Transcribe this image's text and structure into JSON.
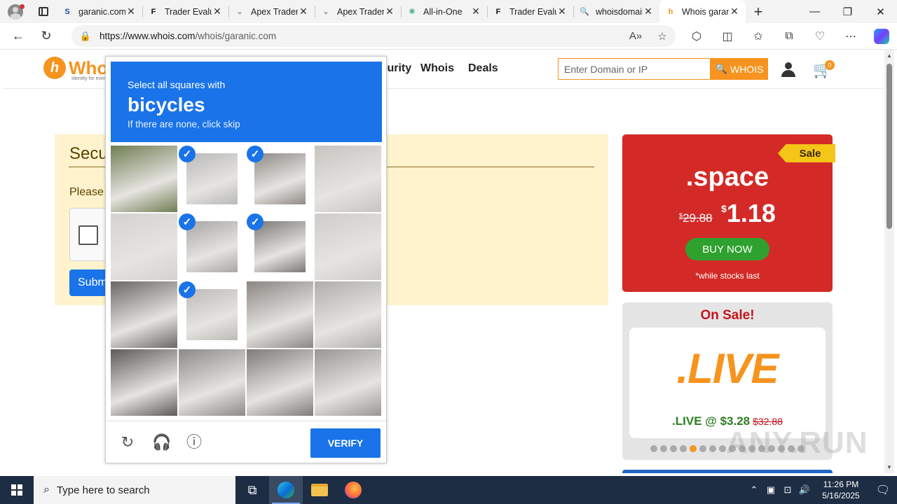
{
  "browser": {
    "tabs": [
      {
        "label": "garanic.com",
        "icon": "s-logo-icon",
        "active": false
      },
      {
        "label": "Trader Evaluation",
        "icon": "f-logo-icon",
        "active": false
      },
      {
        "label": "Apex Trader",
        "icon": "apex-icon",
        "active": false
      },
      {
        "label": "Apex Trader",
        "icon": "apex-icon",
        "active": false
      },
      {
        "label": "All-in-One",
        "icon": "allinone-icon",
        "active": false
      },
      {
        "label": "Trader Evaluation",
        "icon": "f-logo-icon",
        "active": false
      },
      {
        "label": "whoisdomain",
        "icon": "search-icon",
        "active": false
      },
      {
        "label": "Whois garanic.com",
        "icon": "whois-logo-icon",
        "active": true
      }
    ],
    "url_domain": "https://www.whois.com",
    "url_path": "/whois/garanic.com"
  },
  "site": {
    "logo_text": "Whois",
    "logo_tagline": "Identity for everyone",
    "nav": [
      "Security",
      "Whois",
      "Deals"
    ],
    "search_placeholder": "Enter Domain or IP",
    "search_button": "WHOIS",
    "cart_count": "0"
  },
  "security": {
    "title": "Security",
    "prompt": "Please",
    "submit_label": "Submit"
  },
  "promo_space": {
    "ribbon": "Sale",
    "tld": ".space",
    "old_currency": "$",
    "old_price": "29.88",
    "new_currency": "$",
    "new_price": "1.18",
    "button": "BUY NOW",
    "note": "*while stocks last"
  },
  "promo_live": {
    "title": "On Sale!",
    "logo": ".LIVE",
    "price_text": ".LIVE @ $3.28",
    "old_price": "$32.88",
    "dots_total": 16,
    "dots_active_index": 4
  },
  "captcha": {
    "instruction": "Select all squares with",
    "target": "bicycles",
    "skip_hint": "If there are none, click skip",
    "verify_label": "VERIFY",
    "selected_tiles": [
      1,
      2,
      5,
      6,
      9
    ],
    "tile_shades": [
      "#6f7d52",
      "#b9b9b9",
      "#8e8a86",
      "#c7c4c0",
      "#d4d2cf",
      "#a8a6a4",
      "#7b7876",
      "#cfcdca",
      "#6a6866",
      "#bdbbb8",
      "#8a8783",
      "#b0aeab",
      "#5d5b59",
      "#8c8a88",
      "#7e7c7a",
      "#999795"
    ]
  },
  "taskbar": {
    "search_placeholder": "Type here to search",
    "time": "11:26 PM",
    "date": "5/16/2025"
  },
  "watermark": "ANY.RUN",
  "colors": {
    "accent": "#1a73e8",
    "brand_orange": "#f7931e",
    "promo_red": "#d32a27",
    "buy_green": "#2ea12e"
  }
}
